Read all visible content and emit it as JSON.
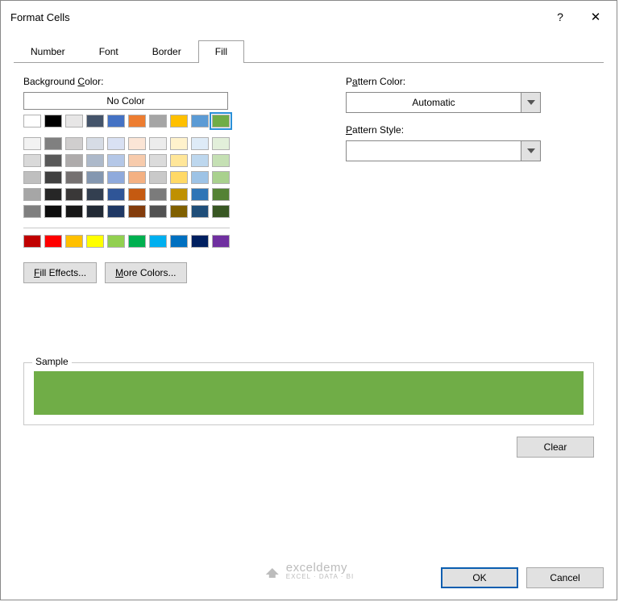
{
  "title": "Format Cells",
  "help_glyph": "?",
  "close_glyph": "✕",
  "tabs": [
    {
      "label": "Number",
      "active": false
    },
    {
      "label": "Font",
      "active": false
    },
    {
      "label": "Border",
      "active": false
    },
    {
      "label": "Fill",
      "active": true
    }
  ],
  "bg_label_pre": "Background ",
  "bg_label_ul": "C",
  "bg_label_post": "olor:",
  "nocolor_label": "No Color",
  "theme_row1": [
    "#ffffff",
    "#000000",
    "#e7e6e6",
    "#44546a",
    "#4472c4",
    "#ed7d31",
    "#a5a5a5",
    "#ffc000",
    "#5b9bd5",
    "#70ad47"
  ],
  "selected_index": 9,
  "theme_tints": [
    [
      "#f2f2f2",
      "#808080",
      "#d0cece",
      "#d6dce5",
      "#d9e1f3",
      "#fbe5d6",
      "#ececec",
      "#fff2cc",
      "#deebf7",
      "#e2efda"
    ],
    [
      "#d9d9d9",
      "#595959",
      "#aeabab",
      "#adb9ca",
      "#b4c7e7",
      "#f7cbac",
      "#dbdbdb",
      "#ffe699",
      "#bdd7ee",
      "#c5e0b4"
    ],
    [
      "#bfbfbf",
      "#404040",
      "#757171",
      "#8497b0",
      "#8faadc",
      "#f4b183",
      "#c9c9c9",
      "#ffd966",
      "#9dc3e6",
      "#a9d18e"
    ],
    [
      "#a6a6a6",
      "#262626",
      "#3a3838",
      "#333f50",
      "#2f5597",
      "#c55a11",
      "#7b7b7b",
      "#bf9000",
      "#2e75b6",
      "#548235"
    ],
    [
      "#7f7f7f",
      "#0d0d0d",
      "#171717",
      "#222a35",
      "#1f3864",
      "#833c0c",
      "#525252",
      "#806000",
      "#1f4e79",
      "#385723"
    ]
  ],
  "standard_colors": [
    "#c00000",
    "#ff0000",
    "#ffc000",
    "#ffff00",
    "#92d050",
    "#00b050",
    "#00b0f0",
    "#0070c0",
    "#002060",
    "#7030a0"
  ],
  "fill_effects_ul": "F",
  "fill_effects_post": "ill Effects...",
  "more_colors_ul": "M",
  "more_colors_post": "ore Colors...",
  "pattern_color_ul": "a",
  "pattern_color_pre": "P",
  "pattern_color_post": "ttern Color:",
  "pattern_color_value": "Automatic",
  "pattern_style_ul": "P",
  "pattern_style_post": "attern Style:",
  "pattern_style_value": "",
  "sample_label": "Sample",
  "sample_color": "#70ad47",
  "clear_ul": "r",
  "clear_pre": "Clea",
  "ok_label": "OK",
  "cancel_label": "Cancel",
  "watermark_main": "exceldemy",
  "watermark_sub": "EXCEL · DATA · BI"
}
